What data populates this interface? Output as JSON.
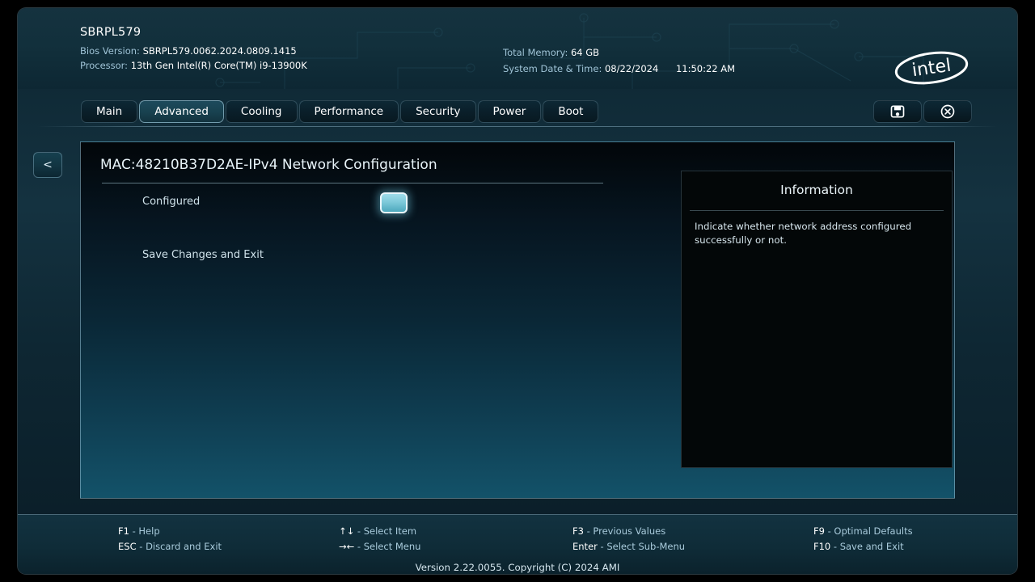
{
  "header": {
    "system_title": "SBRPL579",
    "bios_version_label": "Bios Version:",
    "bios_version_value": "SBRPL579.0062.2024.0809.1415",
    "processor_label": "Processor:",
    "processor_value": "13th Gen Intel(R) Core(TM) i9-13900K",
    "total_memory_label": "Total Memory:",
    "total_memory_value": "64 GB",
    "datetime_label": "System Date & Time:",
    "date_value": "08/22/2024",
    "time_value": "11:50:22 AM",
    "logo_text": "intel",
    "logo_icon": "intel-logo"
  },
  "tabs": [
    {
      "label": "Main",
      "active": false
    },
    {
      "label": "Advanced",
      "active": true
    },
    {
      "label": "Cooling",
      "active": false
    },
    {
      "label": "Performance",
      "active": false
    },
    {
      "label": "Security",
      "active": false
    },
    {
      "label": "Power",
      "active": false
    },
    {
      "label": "Boot",
      "active": false
    }
  ],
  "tab_actions": {
    "save_icon": "save-floppy-icon",
    "close_icon": "close-circle-icon"
  },
  "navigation": {
    "back_label": "<",
    "back_icon": "chevron-left-icon"
  },
  "main": {
    "page_title": "MAC:48210B37D2AE-IPv4 Network Configuration",
    "settings": [
      {
        "label": "Configured",
        "control": "checkbox",
        "checked": true
      },
      {
        "label": "Save Changes and Exit",
        "control": "action"
      }
    ]
  },
  "info_panel": {
    "title": "Information",
    "text": "Indicate whether network address configured successfully or not."
  },
  "footer": {
    "help": [
      {
        "key": "F1",
        "desc": "- Help"
      },
      {
        "key": "ESC",
        "desc": "- Discard and Exit"
      },
      {
        "key": "↑↓",
        "desc": "- Select Item"
      },
      {
        "key": "→←",
        "desc": "- Select Menu"
      },
      {
        "key": "F3",
        "desc": "- Previous Values"
      },
      {
        "key": "Enter",
        "desc": "- Select Sub-Menu"
      },
      {
        "key": "F9",
        "desc": "- Optimal Defaults"
      },
      {
        "key": "F10",
        "desc": "- Save and Exit"
      }
    ],
    "version": "Version 2.22.0055. Copyright (C) 2024 AMI"
  },
  "colors": {
    "accent_cyan": "#7ecada",
    "panel_teal": "#135269",
    "header_blue": "#15323f",
    "text_light": "#ffffff",
    "text_muted": "#a9cbdc"
  }
}
